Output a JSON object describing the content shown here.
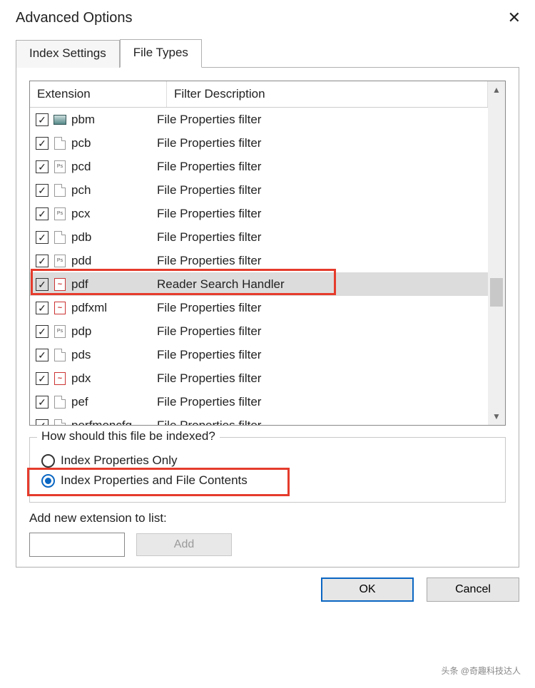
{
  "title": "Advanced Options",
  "tabs": {
    "index_settings": "Index Settings",
    "file_types": "File Types"
  },
  "columns": {
    "extension": "Extension",
    "filter_desc": "Filter Description"
  },
  "rows": [
    {
      "checked": true,
      "icon": "img",
      "ext": "pbm",
      "desc": "File Properties filter",
      "selected": false
    },
    {
      "checked": true,
      "icon": "blank",
      "ext": "pcb",
      "desc": "File Properties filter",
      "selected": false
    },
    {
      "checked": true,
      "icon": "ps",
      "ext": "pcd",
      "desc": "File Properties filter",
      "selected": false
    },
    {
      "checked": true,
      "icon": "blank",
      "ext": "pch",
      "desc": "File Properties filter",
      "selected": false
    },
    {
      "checked": true,
      "icon": "ps",
      "ext": "pcx",
      "desc": "File Properties filter",
      "selected": false
    },
    {
      "checked": true,
      "icon": "blank",
      "ext": "pdb",
      "desc": "File Properties filter",
      "selected": false
    },
    {
      "checked": true,
      "icon": "ps",
      "ext": "pdd",
      "desc": "File Properties filter",
      "selected": false
    },
    {
      "checked": true,
      "icon": "pdf",
      "ext": "pdf",
      "desc": "Reader Search Handler",
      "selected": true
    },
    {
      "checked": true,
      "icon": "pdf",
      "ext": "pdfxml",
      "desc": "File Properties filter",
      "selected": false
    },
    {
      "checked": true,
      "icon": "ps",
      "ext": "pdp",
      "desc": "File Properties filter",
      "selected": false
    },
    {
      "checked": true,
      "icon": "blank",
      "ext": "pds",
      "desc": "File Properties filter",
      "selected": false
    },
    {
      "checked": true,
      "icon": "pdf",
      "ext": "pdx",
      "desc": "File Properties filter",
      "selected": false
    },
    {
      "checked": true,
      "icon": "blank",
      "ext": "pef",
      "desc": "File Properties filter",
      "selected": false
    },
    {
      "checked": true,
      "icon": "blank",
      "ext": "perfmoncfg",
      "desc": "File Properties filter",
      "selected": false
    }
  ],
  "group": {
    "legend": "How should this file be indexed?",
    "opt_props_only": "Index Properties Only",
    "opt_props_contents": "Index Properties and File Contents",
    "selected": "contents"
  },
  "add": {
    "label": "Add new extension to list:",
    "button": "Add",
    "value": ""
  },
  "buttons": {
    "ok": "OK",
    "cancel": "Cancel"
  },
  "watermark": "头条 @奇趣科技达人"
}
